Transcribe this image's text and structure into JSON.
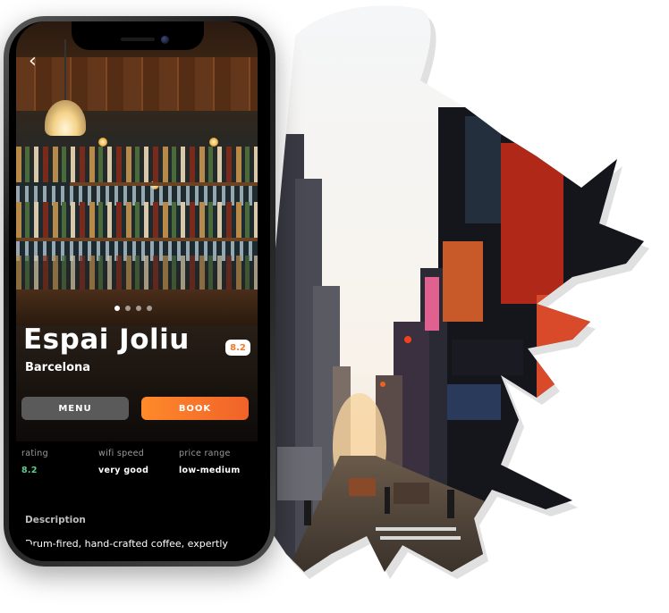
{
  "nav": {
    "back_icon": "chevron-left-icon",
    "back_glyph": "‹"
  },
  "carousel": {
    "count": 4,
    "active_index": 0
  },
  "venue": {
    "name": "Espai Joliu",
    "city": "Barcelona",
    "score": "8.2"
  },
  "actions": {
    "menu_label": "MENU",
    "book_label": "BOOK"
  },
  "stats": [
    {
      "label": "rating",
      "value": "8.2"
    },
    {
      "label": "wifi speed",
      "value": "very good"
    },
    {
      "label": "price range",
      "value": "low-medium"
    }
  ],
  "description": {
    "heading": "Description",
    "text": "Drum-fired, hand-crafted coffee, expertly"
  },
  "colors": {
    "accent": "#f07a2a",
    "rating_green": "#5ad08a",
    "menu_button": "#5a5a5a"
  }
}
